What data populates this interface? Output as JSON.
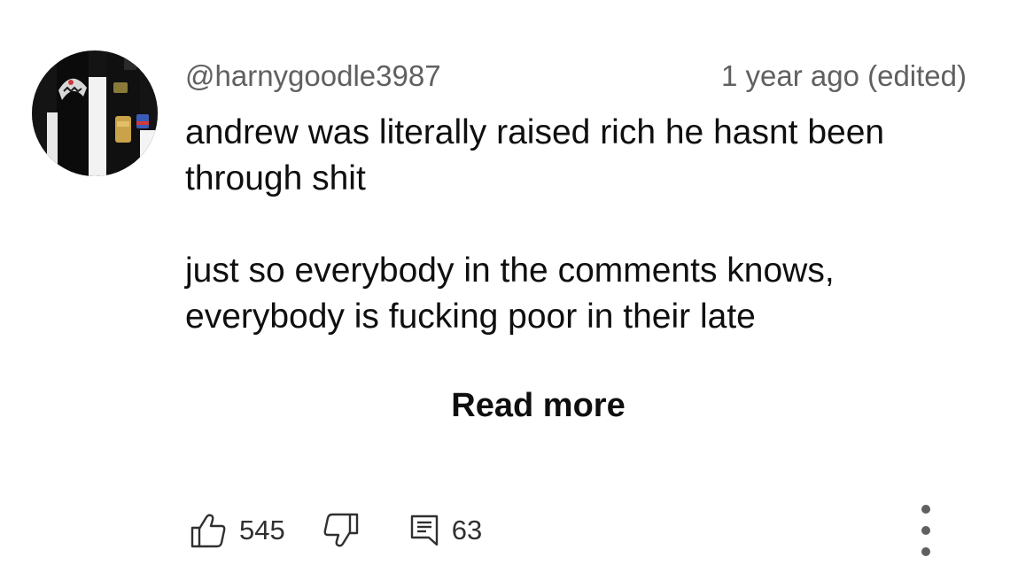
{
  "comment": {
    "author_handle": "@harnygoodle3987",
    "timestamp": "1 year ago (edited)",
    "paragraphs": [
      "andrew was literally raised rich he hasnt been through shit",
      "just so everybody in the comments knows, everybody is fucking poor in their late"
    ],
    "read_more_label": "Read more"
  },
  "actions": {
    "like_icon": "thumbs-up-icon",
    "like_count": "545",
    "dislike_icon": "thumbs-down-icon",
    "reply_icon": "reply-comment-icon",
    "reply_count": "63",
    "more_icon": "vertical-ellipsis-icon"
  },
  "colors": {
    "primary_text": "#0f0f0f",
    "secondary_text": "#606060",
    "background": "#ffffff"
  }
}
